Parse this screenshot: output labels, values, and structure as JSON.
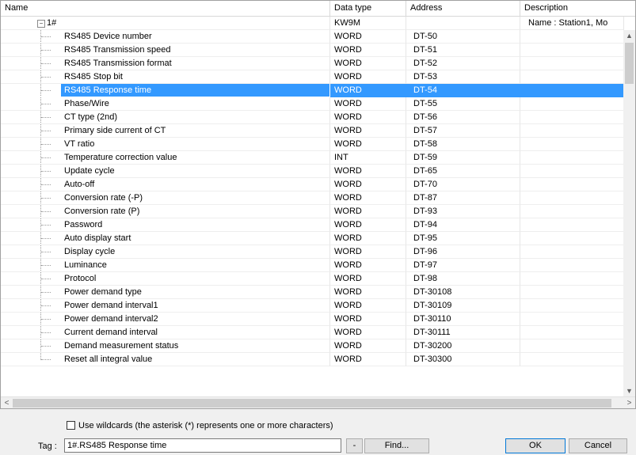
{
  "columns": [
    "Name",
    "Data type",
    "Address",
    "Description"
  ],
  "group": {
    "name": "1#",
    "datatype": "KW9M",
    "description": "Name : Station1, Mo"
  },
  "rows": [
    {
      "name": "RS485 Device number",
      "type": "WORD",
      "addr": "DT-50"
    },
    {
      "name": "RS485 Transmission speed",
      "type": "WORD",
      "addr": "DT-51"
    },
    {
      "name": "RS485 Transmission format",
      "type": "WORD",
      "addr": "DT-52"
    },
    {
      "name": "RS485 Stop bit",
      "type": "WORD",
      "addr": "DT-53"
    },
    {
      "name": "RS485 Response time",
      "type": "WORD",
      "addr": "DT-54"
    },
    {
      "name": "Phase/Wire",
      "type": "WORD",
      "addr": "DT-55"
    },
    {
      "name": "CT type (2nd)",
      "type": "WORD",
      "addr": "DT-56"
    },
    {
      "name": "Primary side current of CT",
      "type": "WORD",
      "addr": "DT-57"
    },
    {
      "name": "VT ratio",
      "type": "WORD",
      "addr": "DT-58"
    },
    {
      "name": "Temperature correction value",
      "type": "INT",
      "addr": "DT-59"
    },
    {
      "name": "Update cycle",
      "type": "WORD",
      "addr": "DT-65"
    },
    {
      "name": "Auto-off",
      "type": "WORD",
      "addr": "DT-70"
    },
    {
      "name": "Conversion rate (-P)",
      "type": "WORD",
      "addr": "DT-87"
    },
    {
      "name": "Conversion rate (P)",
      "type": "WORD",
      "addr": "DT-93"
    },
    {
      "name": "Password",
      "type": "WORD",
      "addr": "DT-94"
    },
    {
      "name": "Auto display start",
      "type": "WORD",
      "addr": "DT-95"
    },
    {
      "name": "Display cycle",
      "type": "WORD",
      "addr": "DT-96"
    },
    {
      "name": "Luminance",
      "type": "WORD",
      "addr": "DT-97"
    },
    {
      "name": "Protocol",
      "type": "WORD",
      "addr": "DT-98"
    },
    {
      "name": "Power demand type",
      "type": "WORD",
      "addr": "DT-30108"
    },
    {
      "name": "Power demand interval1",
      "type": "WORD",
      "addr": "DT-30109"
    },
    {
      "name": "Power demand interval2",
      "type": "WORD",
      "addr": "DT-30110"
    },
    {
      "name": "Current demand interval",
      "type": "WORD",
      "addr": "DT-30111"
    },
    {
      "name": "Demand measurement status",
      "type": "WORD",
      "addr": "DT-30200"
    },
    {
      "name": "Reset all integral value",
      "type": "WORD",
      "addr": "DT-30300"
    }
  ],
  "selected_index": 4,
  "wildcard_label": "Use wildcards (the asterisk (*) represents one or more characters)",
  "tag_label": "Tag :",
  "tag_value": "1#.RS485 Response time",
  "dash_label": "-",
  "find_label": "Find...",
  "ok_label": "OK",
  "cancel_label": "Cancel",
  "icons": {
    "scroll_up": "▲",
    "scroll_down": "▼",
    "scroll_left": "<",
    "scroll_right": ">",
    "expander": "−"
  }
}
